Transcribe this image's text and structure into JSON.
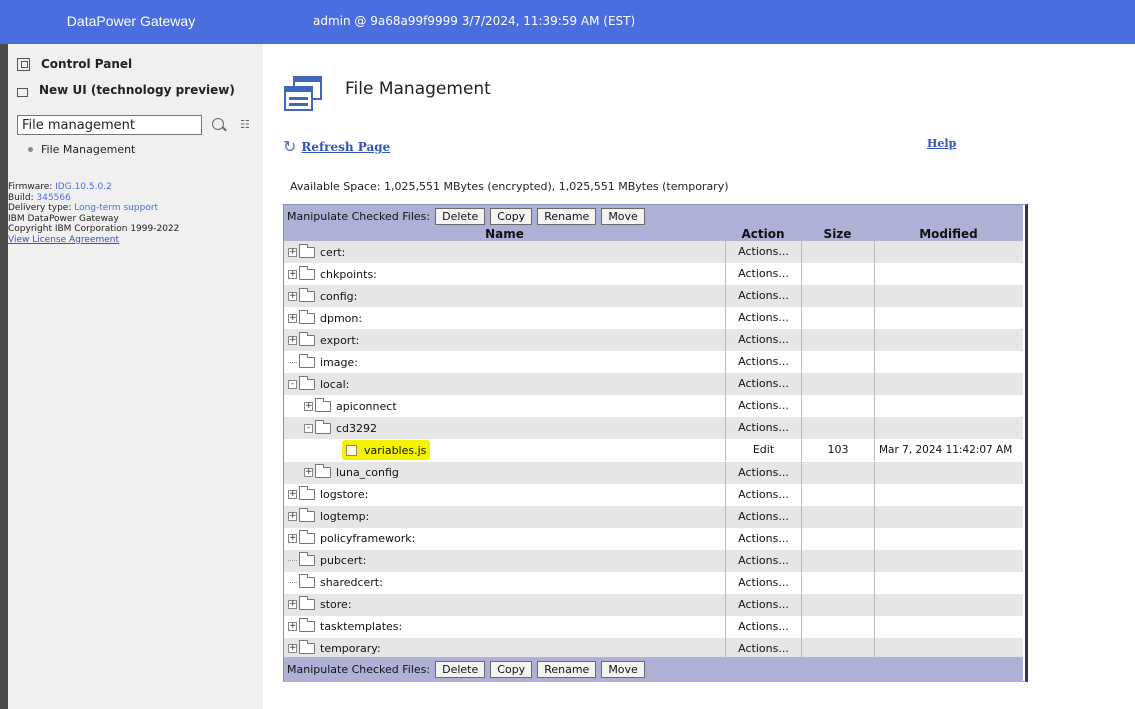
{
  "header": {
    "brand": "DataPower Gateway",
    "session": "admin @ 9a68a99f9999 3/7/2024, 11:39:59 AM (EST)"
  },
  "sidebar": {
    "control_panel": "Control Panel",
    "new_ui": "New UI (technology preview)",
    "search_value": "File management",
    "result": "File Management",
    "firmware_label": "Firmware:",
    "firmware_value": "IDG.10.5.0.2",
    "build_label": "Build:",
    "build_value": "345566",
    "delivery_label": "Delivery type:",
    "delivery_value": "Long-term support",
    "product": "IBM DataPower Gateway",
    "copyright": "Copyright IBM Corporation 1999-2022",
    "license_link": "View License Agreement"
  },
  "main": {
    "title": "File Management",
    "refresh": "Refresh Page",
    "help": "Help",
    "available_space": "Available Space: 1,025,551 MBytes (encrypted), 1,025,551 MBytes (temporary)"
  },
  "toolbar": {
    "label": "Manipulate Checked Files:",
    "delete": "Delete",
    "copy": "Copy",
    "rename": "Rename",
    "move": "Move"
  },
  "table": {
    "headers": {
      "name": "Name",
      "action": "Action",
      "size": "Size",
      "modified": "Modified"
    },
    "rows": [
      {
        "name": "cert:",
        "depth": 0,
        "kind": "folder",
        "expander": "+",
        "action": "Actions...",
        "size": "",
        "modified": ""
      },
      {
        "name": "chkpoints:",
        "depth": 0,
        "kind": "folder",
        "expander": "+",
        "action": "Actions...",
        "size": "",
        "modified": ""
      },
      {
        "name": "config:",
        "depth": 0,
        "kind": "folder",
        "expander": "+",
        "action": "Actions...",
        "size": "",
        "modified": ""
      },
      {
        "name": "dpmon:",
        "depth": 0,
        "kind": "folder",
        "expander": "+",
        "action": "Actions...",
        "size": "",
        "modified": ""
      },
      {
        "name": "export:",
        "depth": 0,
        "kind": "folder",
        "expander": "+",
        "action": "Actions...",
        "size": "",
        "modified": ""
      },
      {
        "name": "image:",
        "depth": 0,
        "kind": "folder",
        "expander": "",
        "action": "Actions...",
        "size": "",
        "modified": ""
      },
      {
        "name": "local:",
        "depth": 0,
        "kind": "folder",
        "expander": "-",
        "action": "Actions...",
        "size": "",
        "modified": ""
      },
      {
        "name": "apiconnect",
        "depth": 1,
        "kind": "folder",
        "expander": "+",
        "action": "Actions...",
        "size": "",
        "modified": ""
      },
      {
        "name": "cd3292",
        "depth": 1,
        "kind": "folder",
        "expander": "-",
        "action": "Actions...",
        "size": "",
        "modified": ""
      },
      {
        "name": "variables.js",
        "depth": 2,
        "kind": "file",
        "expander": "",
        "action": "Edit",
        "size": "103",
        "modified": "Mar 7, 2024 11:42:07 AM"
      },
      {
        "name": "luna_config",
        "depth": 1,
        "kind": "folder",
        "expander": "+",
        "action": "Actions...",
        "size": "",
        "modified": ""
      },
      {
        "name": "logstore:",
        "depth": 0,
        "kind": "folder",
        "expander": "+",
        "action": "Actions...",
        "size": "",
        "modified": ""
      },
      {
        "name": "logtemp:",
        "depth": 0,
        "kind": "folder",
        "expander": "+",
        "action": "Actions...",
        "size": "",
        "modified": ""
      },
      {
        "name": "policyframework:",
        "depth": 0,
        "kind": "folder",
        "expander": "+",
        "action": "Actions...",
        "size": "",
        "modified": ""
      },
      {
        "name": "pubcert:",
        "depth": 0,
        "kind": "folder",
        "expander": "",
        "action": "Actions...",
        "size": "",
        "modified": ""
      },
      {
        "name": "sharedcert:",
        "depth": 0,
        "kind": "folder",
        "expander": "",
        "action": "Actions...",
        "size": "",
        "modified": ""
      },
      {
        "name": "store:",
        "depth": 0,
        "kind": "folder",
        "expander": "+",
        "action": "Actions...",
        "size": "",
        "modified": ""
      },
      {
        "name": "tasktemplates:",
        "depth": 0,
        "kind": "folder",
        "expander": "+",
        "action": "Actions...",
        "size": "",
        "modified": ""
      },
      {
        "name": "temporary:",
        "depth": 0,
        "kind": "folder",
        "expander": "+",
        "action": "Actions...",
        "size": "",
        "modified": ""
      }
    ]
  },
  "colors": {
    "header": "#4a6ee0",
    "toolbar": "#aeb0d6",
    "highlight": "#f4f200",
    "link": "#3355bb"
  },
  "icons": {
    "control_panel": "control-panel-icon",
    "new_ui": "window-icon",
    "search": "search-icon",
    "tree": "tree-view-icon",
    "page": "file-management-icon",
    "refresh": "refresh-icon",
    "folder": "folder-icon",
    "file": "file-checkbox"
  }
}
